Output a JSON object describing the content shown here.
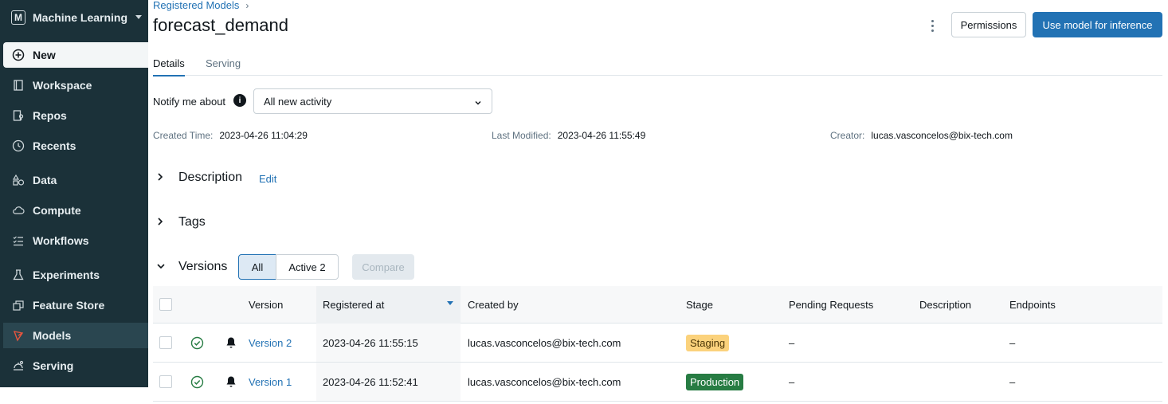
{
  "sidebar": {
    "workspace": "Machine Learning",
    "workspace_logo": "M",
    "items": [
      {
        "label": "New",
        "icon": "plus-circle-icon"
      },
      {
        "label": "Workspace",
        "icon": "notebook-icon"
      },
      {
        "label": "Repos",
        "icon": "repo-icon"
      },
      {
        "label": "Recents",
        "icon": "clock-icon"
      },
      {
        "label": "Data",
        "icon": "shapes-icon"
      },
      {
        "label": "Compute",
        "icon": "cloud-icon"
      },
      {
        "label": "Workflows",
        "icon": "workflow-list-icon"
      },
      {
        "label": "Experiments",
        "icon": "beaker-icon"
      },
      {
        "label": "Feature Store",
        "icon": "store-icon"
      },
      {
        "label": "Models",
        "icon": "model-icon"
      },
      {
        "label": "Serving",
        "icon": "serving-icon"
      }
    ]
  },
  "breadcrumb": {
    "label": "Registered Models",
    "separator": "›"
  },
  "page": {
    "title": "forecast_demand"
  },
  "header": {
    "permissions_label": "Permissions",
    "use_model_label": "Use model for inference"
  },
  "tabs": [
    {
      "label": "Details",
      "active": true
    },
    {
      "label": "Serving",
      "active": false
    }
  ],
  "notify": {
    "label": "Notify me about",
    "info": "i",
    "selected": "All new activity"
  },
  "meta": {
    "created_label": "Created Time:",
    "created_value": "2023-04-26 11:04:29",
    "modified_label": "Last Modified:",
    "modified_value": "2023-04-26 11:55:49",
    "creator_label": "Creator:",
    "creator_value": "lucas.vasconcelos@bix-tech.com"
  },
  "sections": {
    "description": "Description",
    "edit": "Edit",
    "tags": "Tags",
    "versions": "Versions"
  },
  "filters": {
    "all": "All",
    "active": "Active 2",
    "compare": "Compare"
  },
  "table": {
    "columns": [
      "Version",
      "Registered at",
      "Created by",
      "Stage",
      "Pending Requests",
      "Description",
      "Endpoints"
    ],
    "rows": [
      {
        "version": "Version 2",
        "registered_at": "2023-04-26 11:55:15",
        "created_by": "lucas.vasconcelos@bix-tech.com",
        "stage": "Staging",
        "pending": "–",
        "description": "",
        "endpoints": "–"
      },
      {
        "version": "Version 1",
        "registered_at": "2023-04-26 11:52:41",
        "created_by": "lucas.vasconcelos@bix-tech.com",
        "stage": "Production",
        "pending": "–",
        "description": "",
        "endpoints": "–"
      }
    ]
  },
  "colors": {
    "sidebar_bg": "#1b3139",
    "accent": "#2272b4",
    "staging": "#fbd27c",
    "production": "#277c43",
    "models_icon": "#e8553e"
  }
}
